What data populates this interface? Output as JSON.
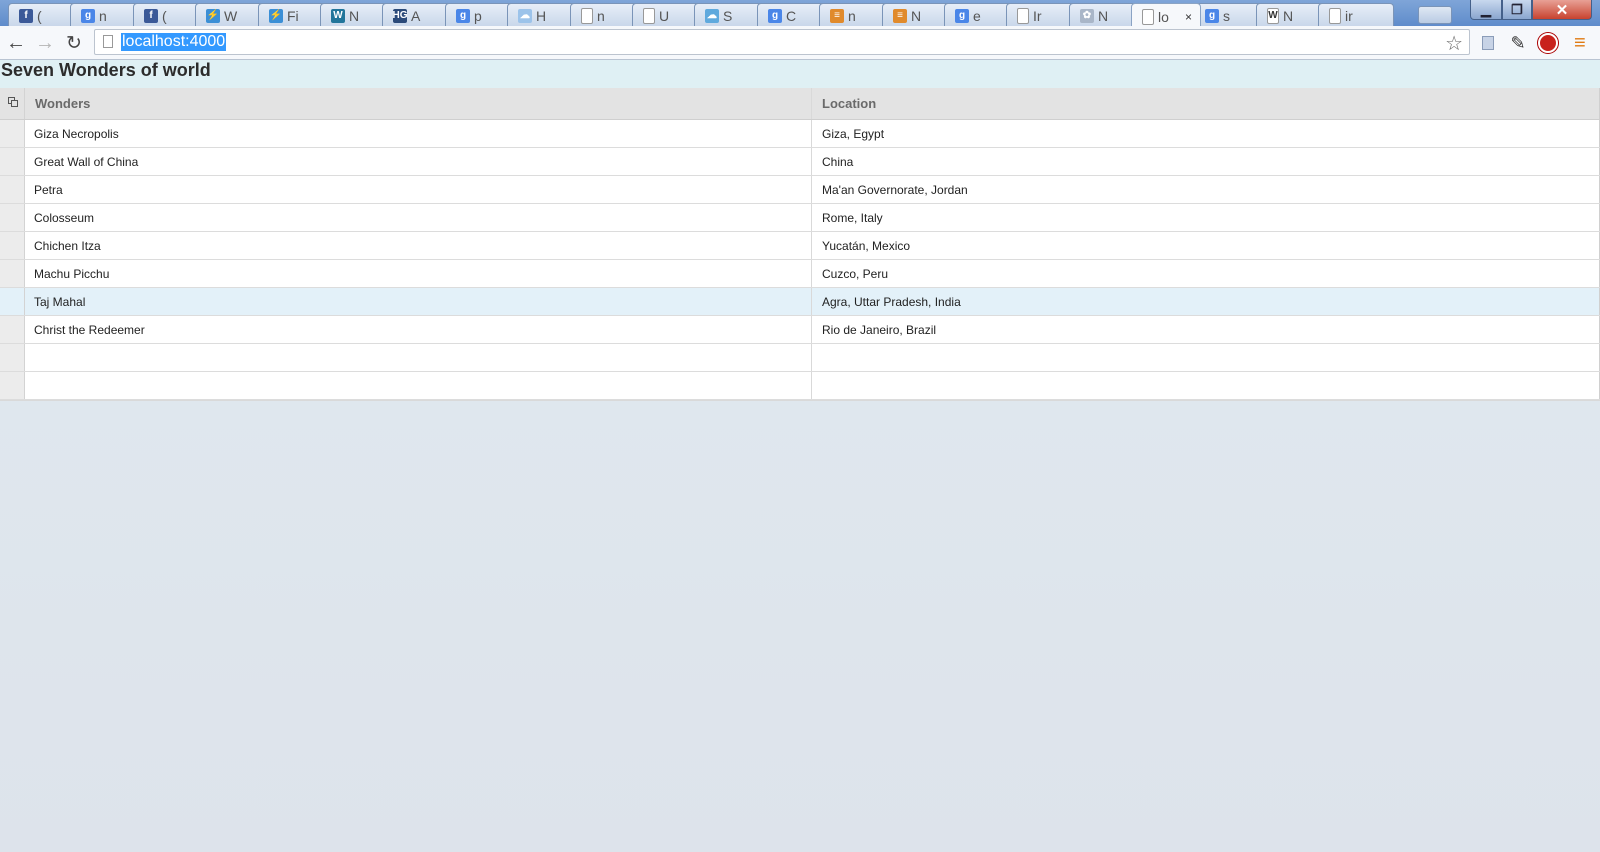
{
  "browser": {
    "tabs": [
      {
        "label": "(",
        "icon": "facebook-icon",
        "color": "#3b5998",
        "glyph": "f"
      },
      {
        "label": "n",
        "icon": "google-icon",
        "color": "#4a86e8",
        "glyph": "g"
      },
      {
        "label": "(",
        "icon": "facebook-icon",
        "color": "#3b5998",
        "glyph": "f"
      },
      {
        "label": "W",
        "icon": "bolt-icon",
        "color": "#3b8fd6",
        "glyph": "⚡"
      },
      {
        "label": "Fi",
        "icon": "bolt-icon",
        "color": "#3b8fd6",
        "glyph": "⚡"
      },
      {
        "label": "N",
        "icon": "wordpress-icon",
        "color": "#21759b",
        "glyph": "W"
      },
      {
        "label": "A",
        "icon": "hg-icon",
        "color": "#2b4a7a",
        "glyph": "HG"
      },
      {
        "label": "p",
        "icon": "google-icon",
        "color": "#4a86e8",
        "glyph": "g"
      },
      {
        "label": "H",
        "icon": "cloud-icon",
        "color": "#9cc3ea",
        "glyph": "☁"
      },
      {
        "label": "n",
        "icon": "page-icon",
        "color": "#ffffff",
        "glyph": ""
      },
      {
        "label": "U",
        "icon": "page-icon",
        "color": "#ffffff",
        "glyph": ""
      },
      {
        "label": "S",
        "icon": "salesforce-icon",
        "color": "#5fa9dd",
        "glyph": "☁"
      },
      {
        "label": "C",
        "icon": "google-icon",
        "color": "#4a86e8",
        "glyph": "g"
      },
      {
        "label": "n",
        "icon": "stack-icon",
        "color": "#e08a2c",
        "glyph": "≡"
      },
      {
        "label": "N",
        "icon": "stack-icon",
        "color": "#e08a2c",
        "glyph": "≡"
      },
      {
        "label": "e",
        "icon": "google-icon",
        "color": "#4a86e8",
        "glyph": "g"
      },
      {
        "label": "Ir",
        "icon": "page-icon",
        "color": "#ffffff",
        "glyph": ""
      },
      {
        "label": "N",
        "icon": "gear-icon",
        "color": "#a9b6c8",
        "glyph": "✿"
      },
      {
        "label": "lo",
        "icon": "page-icon",
        "color": "#ffffff",
        "glyph": "",
        "active": true
      },
      {
        "label": "s",
        "icon": "google-icon",
        "color": "#4a86e8",
        "glyph": "g"
      },
      {
        "label": "N",
        "icon": "wikipedia-icon",
        "color": "#ffffff",
        "glyph": "W"
      },
      {
        "label": "ir",
        "icon": "page-icon",
        "color": "#ffffff",
        "glyph": ""
      }
    ],
    "tab_close": "×",
    "url": "localhost:4000"
  },
  "page": {
    "title": "Seven Wonders of world",
    "columns": [
      "Wonders",
      "Location"
    ],
    "rows": [
      [
        "Giza Necropolis",
        "Giza, Egypt"
      ],
      [
        "Great Wall of China",
        "China"
      ],
      [
        "Petra",
        "Ma'an Governorate, Jordan"
      ],
      [
        "Colosseum",
        "Rome, Italy"
      ],
      [
        "Chichen Itza",
        "Yucatán, Mexico"
      ],
      [
        "Machu Picchu",
        "Cuzco, Peru"
      ],
      [
        "Taj Mahal",
        "Agra, Uttar Pradesh, India"
      ],
      [
        "Christ the Redeemer",
        "Rio de Janeiro, Brazil"
      ],
      [
        "",
        ""
      ],
      [
        "",
        ""
      ]
    ],
    "selected_row": 6
  }
}
